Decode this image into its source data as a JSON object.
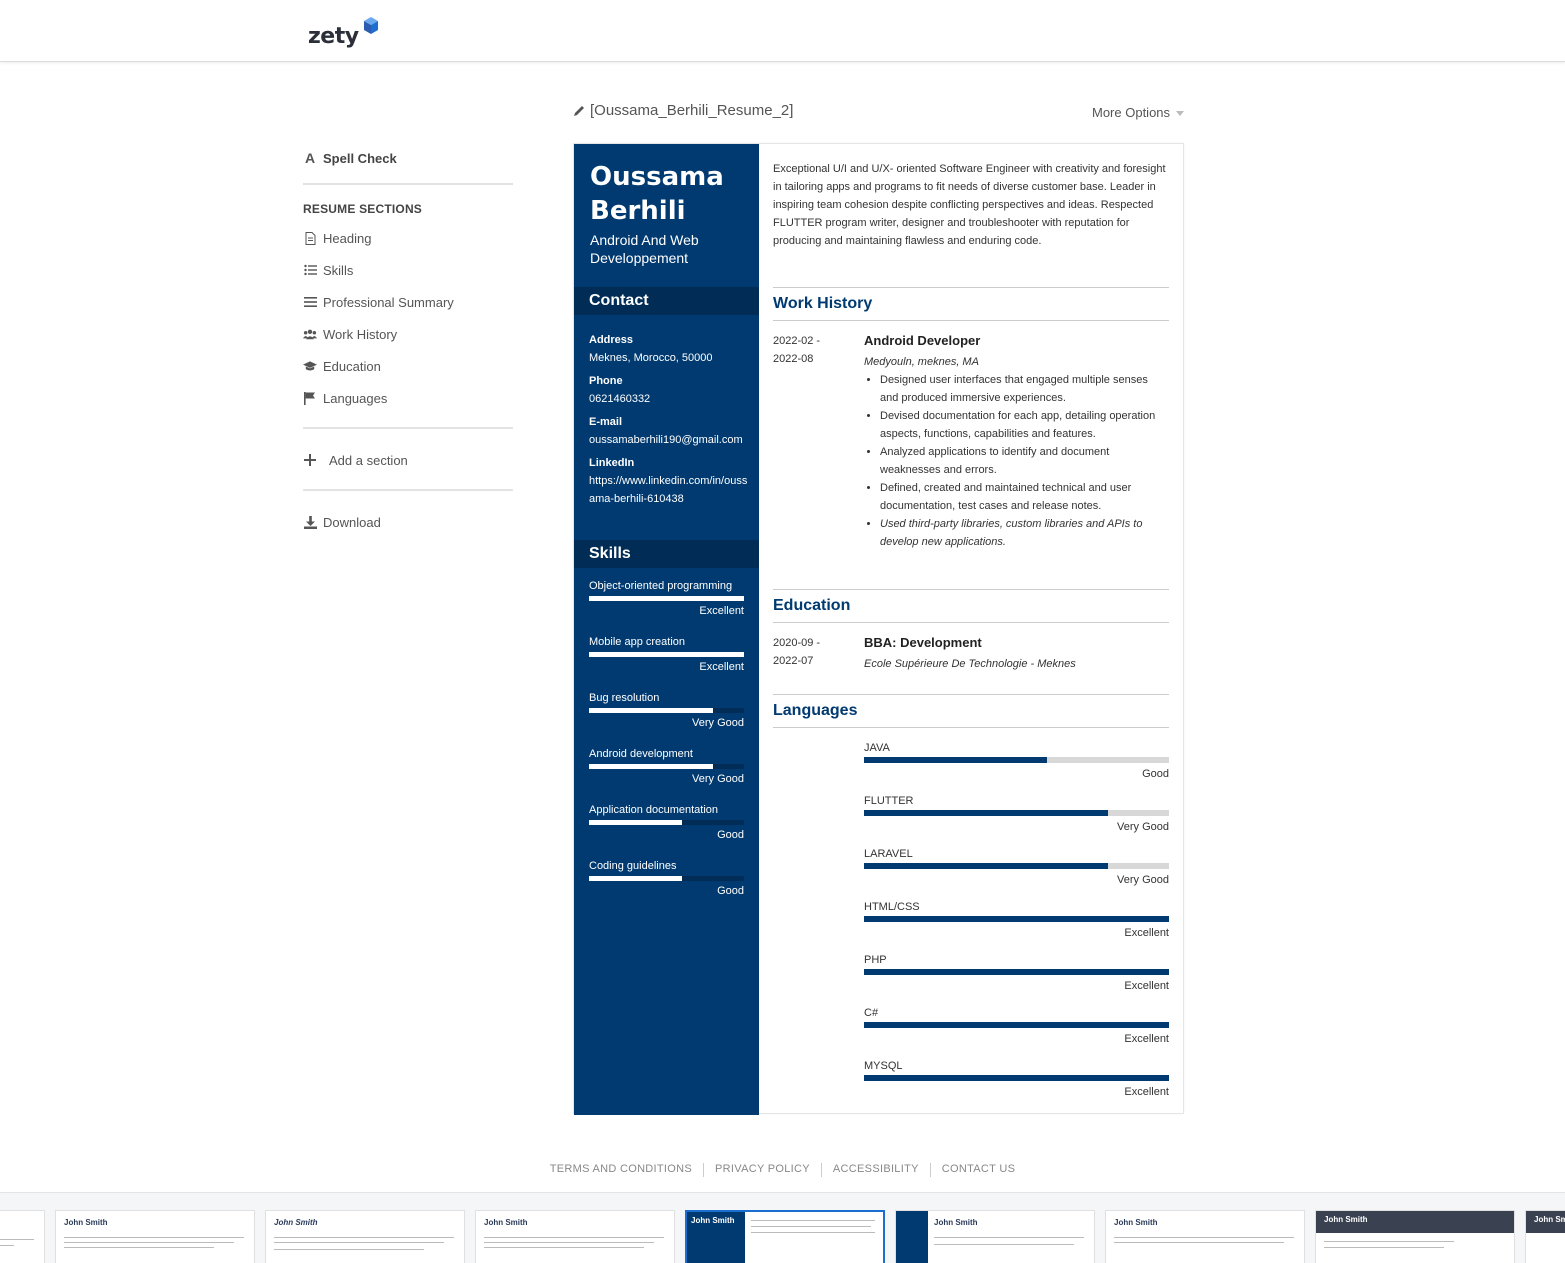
{
  "header": {
    "logo_text": "zety"
  },
  "document": {
    "title": "[Oussama_Berhili_Resume_2]",
    "more_options": "More Options"
  },
  "sidebar": {
    "spell_check": "Spell Check",
    "sections_heading": "RESUME SECTIONS",
    "items": [
      {
        "label": "Heading",
        "icon": "document-icon"
      },
      {
        "label": "Skills",
        "icon": "list-icon"
      },
      {
        "label": "Professional Summary",
        "icon": "lines-icon"
      },
      {
        "label": "Work History",
        "icon": "users-icon"
      },
      {
        "label": "Education",
        "icon": "graduation-cap-icon"
      },
      {
        "label": "Languages",
        "icon": "flag-icon"
      }
    ],
    "add_section": "Add a section",
    "download": "Download"
  },
  "resume": {
    "name": "Oussama Berhili",
    "job_title": "Android And Web Developpement",
    "contact_heading": "Contact",
    "contact": {
      "address_label": "Address",
      "address": "Meknes, Morocco, 50000",
      "phone_label": "Phone",
      "phone": "0621460332",
      "email_label": "E-mail",
      "email": "oussamaberhili190@gmail.com",
      "linkedin_label": "LinkedIn",
      "linkedin": "https://www.linkedin.com/in/oussama-berhili-610438"
    },
    "skills_heading": "Skills",
    "skills": [
      {
        "name": "Object-oriented programming",
        "level": "Excellent",
        "fraction": 1.0
      },
      {
        "name": "Mobile app creation",
        "level": "Excellent",
        "fraction": 1.0
      },
      {
        "name": "Bug resolution",
        "level": "Very Good",
        "fraction": 0.8
      },
      {
        "name": "Android development",
        "level": "Very Good",
        "fraction": 0.8
      },
      {
        "name": "Application documentation",
        "level": "Good",
        "fraction": 0.6
      },
      {
        "name": "Coding guidelines",
        "level": "Good",
        "fraction": 0.6
      }
    ],
    "summary": "Exceptional U/I and U/X- oriented Software Engineer with creativity and foresight in tailoring apps and programs to fit needs of diverse customer base. Leader in inspiring team cohesion despite conflicting perspectives and ideas. Respected FLUTTER program writer, designer and troubleshooter with reputation for producing and maintaining flawless and enduring code.",
    "work_heading": "Work History",
    "work": {
      "date_start": "2022-02 -",
      "date_end": "2022-08",
      "title": "Android Developer",
      "company": "Medyouln, meknes, MA",
      "bullets": [
        "Designed user interfaces that engaged multiple senses and produced immersive experiences.",
        "Devised documentation for each app, detailing operation aspects, functions, capabilities and features.",
        "Analyzed applications to identify and document weaknesses and errors.",
        "Defined, created and maintained technical and user documentation, test cases and release notes.",
        "Used third-party libraries, custom libraries and APIs to develop new applications."
      ]
    },
    "education_heading": "Education",
    "education": {
      "date_start": "2020-09 -",
      "date_end": "2022-07",
      "degree": "BBA: Development",
      "school": "Ecole Supérieure De Technologie - Meknes"
    },
    "languages_heading": "Languages",
    "languages": [
      {
        "name": "JAVA",
        "level": "Good",
        "fraction": 0.6
      },
      {
        "name": "FLUTTER",
        "level": "Very Good",
        "fraction": 0.8
      },
      {
        "name": "LARAVEL",
        "level": "Very Good",
        "fraction": 0.8
      },
      {
        "name": "HTML/CSS",
        "level": "Excellent",
        "fraction": 1.0
      },
      {
        "name": "PHP",
        "level": "Excellent",
        "fraction": 1.0
      },
      {
        "name": "C#",
        "level": "Excellent",
        "fraction": 1.0
      },
      {
        "name": "MYSQL",
        "level": "Excellent",
        "fraction": 1.0
      }
    ]
  },
  "footer": {
    "links": [
      "TERMS AND CONDITIONS",
      "PRIVACY POLICY",
      "ACCESSIBILITY",
      "CONTACT US"
    ]
  },
  "templates": {
    "sample_name": "John Smith"
  },
  "colors": {
    "primary": "#003a70",
    "primary_dark": "#002c56",
    "accent": "#1c6fd1"
  }
}
